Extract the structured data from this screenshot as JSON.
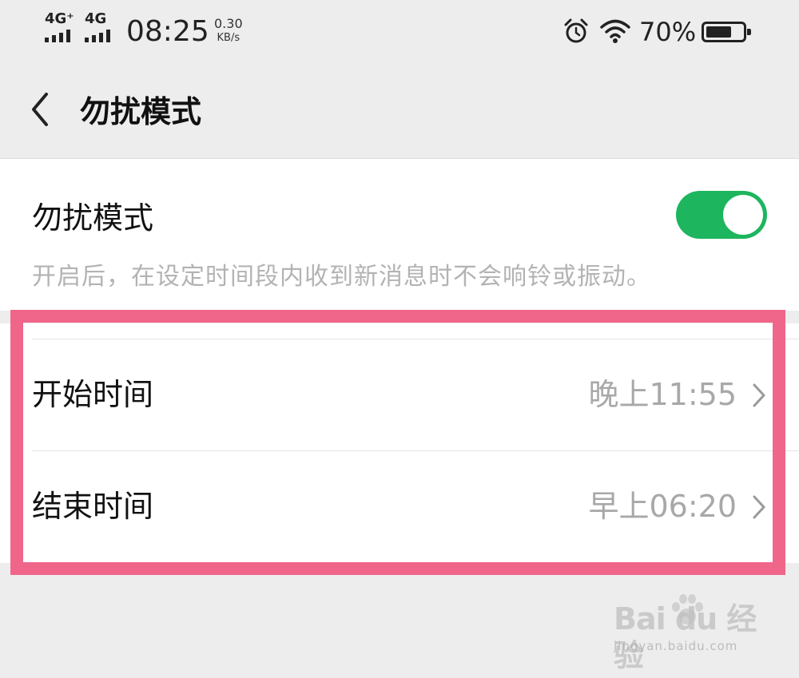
{
  "status_bar": {
    "network1": "4G⁺",
    "network2": "4G",
    "time": "08:25",
    "speed_value": "0.30",
    "speed_unit": "KB/s",
    "battery_percent": "70%",
    "battery_level": 0.7,
    "icons": [
      "signal-icon",
      "alarm-icon",
      "wifi-icon",
      "battery-icon"
    ]
  },
  "nav": {
    "back_icon": "back-arrow-icon",
    "title": "勿扰模式"
  },
  "dnd": {
    "label": "勿扰模式",
    "enabled": true,
    "description": "开启后，在设定时间段内收到新消息时不会响铃或振动。"
  },
  "schedule": [
    {
      "label": "开始时间",
      "value": "晚上11:55"
    },
    {
      "label": "结束时间",
      "value": "早上06:20"
    }
  ],
  "watermark": {
    "main": "Bai du 经验",
    "sub": "jingyan.baidu.com"
  },
  "colors": {
    "toggle_on": "#1db55e",
    "highlight": "#f0668b",
    "background": "#ededed"
  }
}
